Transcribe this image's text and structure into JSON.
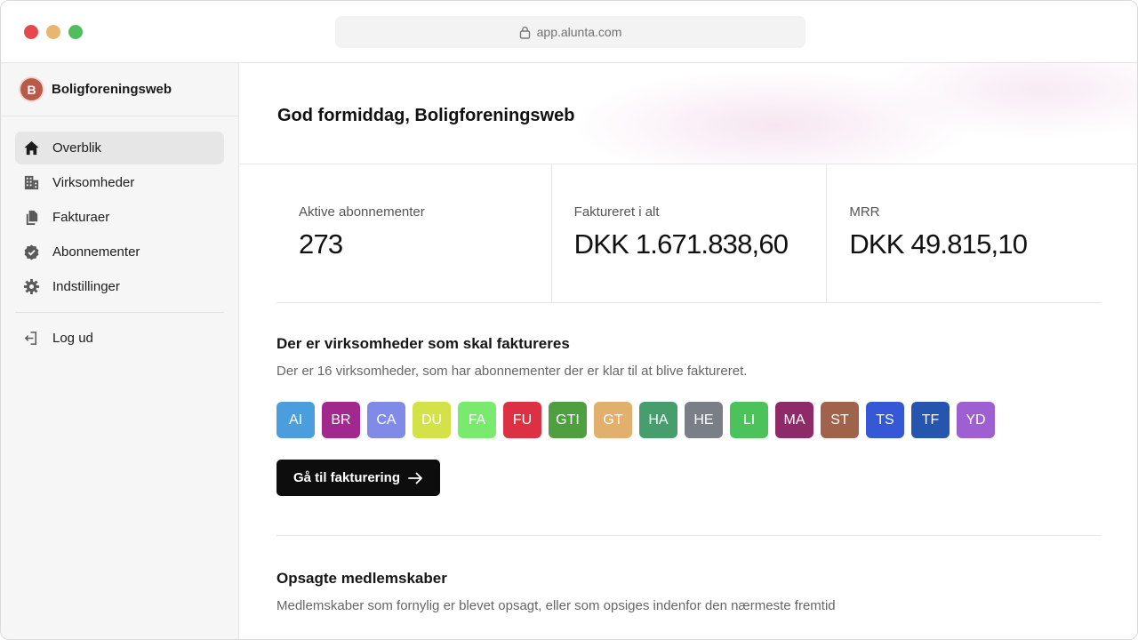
{
  "browser": {
    "url": "app.alunta.com",
    "icons": [
      "lock-icon"
    ]
  },
  "sidebar": {
    "org_initial": "B",
    "org_name": "Boligforeningsweb",
    "items": [
      {
        "label": "Overblik",
        "icon": "home-icon",
        "active": true
      },
      {
        "label": "Virksomheder",
        "icon": "building-icon"
      },
      {
        "label": "Fakturaer",
        "icon": "documents-icon"
      },
      {
        "label": "Abonnementer",
        "icon": "badge-check-icon"
      },
      {
        "label": "Indstillinger",
        "icon": "gear-icon"
      }
    ],
    "logout": {
      "label": "Log ud",
      "icon": "logout-icon"
    }
  },
  "main": {
    "greeting": "God formiddag, Boligforeningsweb",
    "stats": [
      {
        "label": "Aktive abonnementer",
        "value": "273"
      },
      {
        "label": "Faktureret i alt",
        "value": "DKK 1.671.838,60"
      },
      {
        "label": "MRR",
        "value": "DKK 49.815,10"
      }
    ],
    "billing": {
      "title": "Der er virksomheder som skal faktureres",
      "description": "Der er 16 virksomheder, som har abonnementer der er klar til at blive faktureret.",
      "badges": [
        {
          "text": "AI",
          "color": "#4a9ede"
        },
        {
          "text": "BR",
          "color": "#a3288e"
        },
        {
          "text": "CA",
          "color": "#7f8be6"
        },
        {
          "text": "DU",
          "color": "#d4e24a"
        },
        {
          "text": "FA",
          "color": "#79ea6e"
        },
        {
          "text": "FU",
          "color": "#dc3142"
        },
        {
          "text": "GTI",
          "color": "#4f9e3f"
        },
        {
          "text": "GT",
          "color": "#e0b06c"
        },
        {
          "text": "HA",
          "color": "#469e6c"
        },
        {
          "text": "HE",
          "color": "#7a7f87"
        },
        {
          "text": "LI",
          "color": "#4cc35a"
        },
        {
          "text": "MA",
          "color": "#8e2a67"
        },
        {
          "text": "ST",
          "color": "#a0624a"
        },
        {
          "text": "TS",
          "color": "#3658d6"
        },
        {
          "text": "TF",
          "color": "#2655b0"
        },
        {
          "text": "YD",
          "color": "#9d5fd2"
        }
      ],
      "button_label": "Gå til fakturering",
      "button_icon": "arrow-right-icon"
    },
    "cancelled": {
      "title": "Opsagte medlemskaber",
      "description": "Medlemskaber som fornylig er blevet opsagt, eller som opsiges indenfor den nærmeste fremtid"
    }
  }
}
